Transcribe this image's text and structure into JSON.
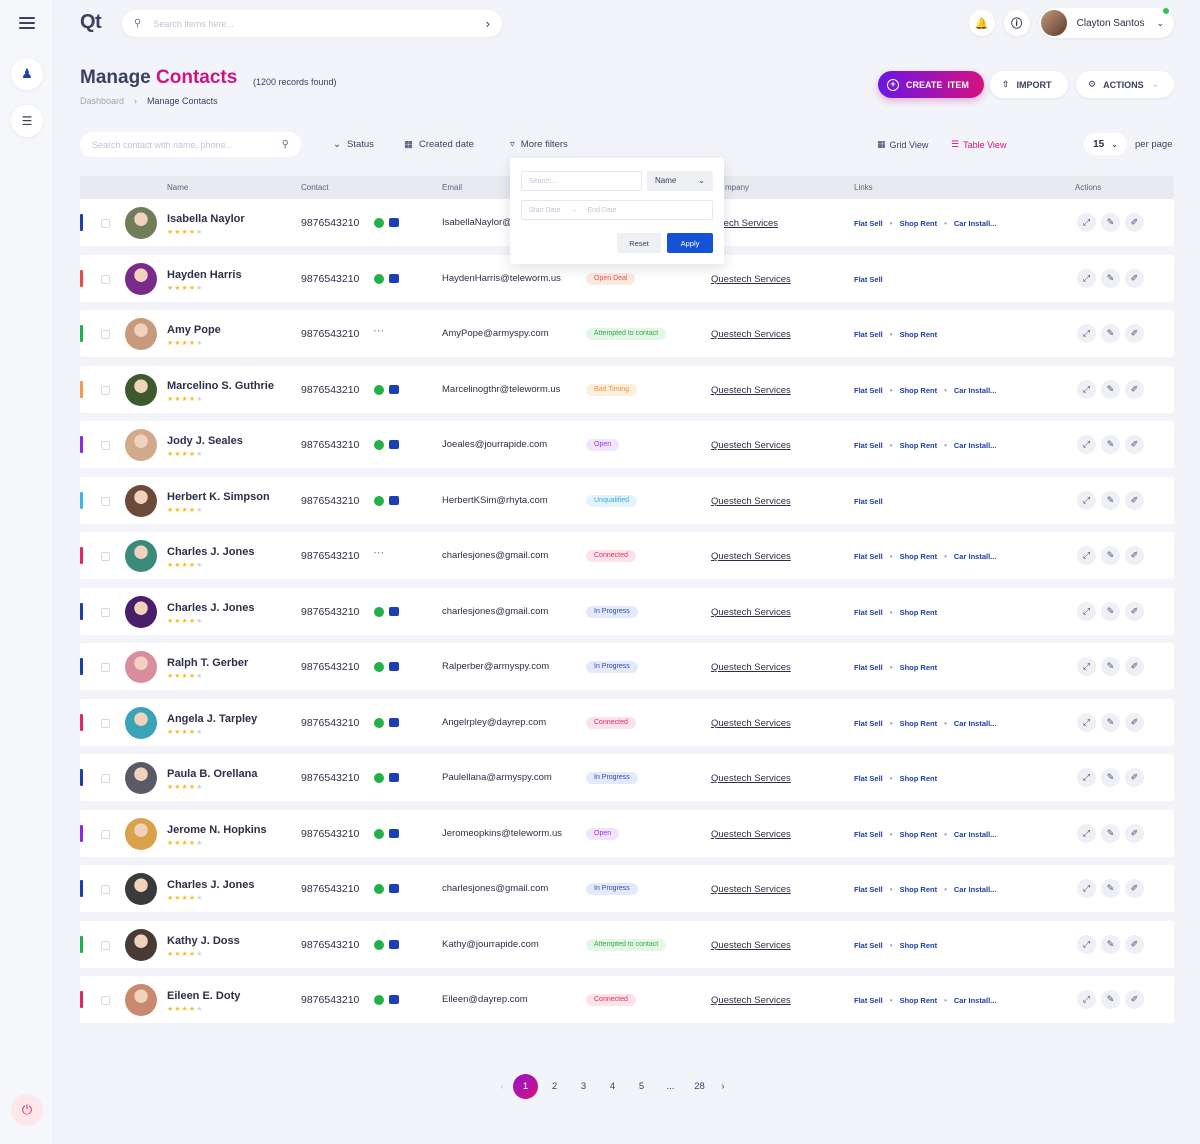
{
  "app": {
    "logo": "Qt"
  },
  "search": {
    "placeholder": "Search items here..."
  },
  "user": {
    "name": "Clayton Santos"
  },
  "header": {
    "title_part1": "Manage ",
    "title_part2": "Contacts",
    "records": "(1200 records found)"
  },
  "breadcrumb": {
    "home": "Dashboard",
    "separator": "›",
    "current": "Manage Contacts"
  },
  "toolbar": {
    "create_label": "CREATE  ITEM",
    "import_label": "IMPORT",
    "actions_label": "ACTIONS"
  },
  "filters": {
    "search_placeholder": "Search contact with name, phone...",
    "status": "Status",
    "created_date": "Created date",
    "more_filters": "More filters",
    "grid_view": "Grid View",
    "table_view": "Table View",
    "per_page_value": "15",
    "per_page_label": "per page"
  },
  "dropdown": {
    "search_placeholder": "Search...",
    "select_value": "Name",
    "start_date": "Start Date",
    "date_sep": "→",
    "end_date": "End Date",
    "reset": "Reset",
    "apply": "Apply"
  },
  "table": {
    "headers": {
      "name": "Name",
      "contact": "Contact",
      "email": "Email",
      "company": "mpany",
      "links": "Links",
      "actions": "Actions"
    },
    "company_name": "Questech Services",
    "link_labels": [
      "Flat Sell",
      "Shop Rent",
      "Car Install..."
    ],
    "rows": [
      {
        "name": "Isabella Naylor",
        "phone": "9876543210",
        "email": "IsabellaNaylor@",
        "status": "",
        "links": 3,
        "color": "#1e3ea8",
        "icons": true,
        "company": "estech Services",
        "avatar": "#6f7d5a"
      },
      {
        "name": "Hayden Harris",
        "phone": "9876543210",
        "email": "HaydenHarris@teleworm.us",
        "status": "Open Deal",
        "links": 1,
        "color": "#f04a3e",
        "icons": true,
        "avatar": "#7a2a8a"
      },
      {
        "name": "Amy Pope",
        "phone": "9876543210",
        "email": "AmyPope@armyspy.com",
        "status": "Attempted to contact",
        "links": 2,
        "color": "#22b04a",
        "icons": false,
        "avatar": "#c89a7d"
      },
      {
        "name": "Marcelino S. Guthrie",
        "phone": "9876543210",
        "email": "Marcelinogthr@teleworm.us",
        "status": "Bad Timing",
        "links": 3,
        "color": "#f49a4c",
        "icons": true,
        "avatar": "#3e5a2c"
      },
      {
        "name": "Jody J. Seales",
        "phone": "9876543210",
        "email": "Joeales@jourrapide.com",
        "status": "Open",
        "links": 3,
        "color": "#8a2be2",
        "icons": true,
        "avatar": "#d2a98a"
      },
      {
        "name": "Herbert K. Simpson",
        "phone": "9876543210",
        "email": "HerbertKSim@rhyta.com",
        "status": "Unqualified",
        "links": 1,
        "color": "#3fb4e8",
        "icons": true,
        "avatar": "#6b4a3c"
      },
      {
        "name": "Charles J. Jones",
        "phone": "9876543210",
        "email": "charlesjones@gmail.com",
        "status": "Connected",
        "links": 3,
        "color": "#e0295f",
        "icons": false,
        "avatar": "#3b8a7a"
      },
      {
        "name": "Charles J. Jones",
        "phone": "9876543210",
        "email": "charlesjones@gmail.com",
        "status": "In Progress",
        "links": 2,
        "color": "#1e3ea8",
        "icons": true,
        "avatar": "#4a1e6a"
      },
      {
        "name": "Ralph T. Gerber",
        "phone": "9876543210",
        "email": "Ralperber@armyspy.com",
        "status": "In Progress",
        "links": 2,
        "color": "#1e3ea8",
        "icons": true,
        "avatar": "#d98ea0"
      },
      {
        "name": "Angela J. Tarpley",
        "phone": "9876543210",
        "email": "Angelrpley@dayrep.com",
        "status": "Connected",
        "links": 3,
        "color": "#e0295f",
        "icons": true,
        "avatar": "#3aa3b8"
      },
      {
        "name": "Paula B. Orellana",
        "phone": "9876543210",
        "email": "Paulellana@armyspy.com",
        "status": "In Progress",
        "links": 2,
        "color": "#1e3ea8",
        "icons": true,
        "avatar": "#5a5a66"
      },
      {
        "name": "Jerome N. Hopkins",
        "phone": "9876543210",
        "email": "Jeromeopkins@teleworm.us",
        "status": "Open",
        "links": 3,
        "color": "#8a2be2",
        "icons": true,
        "avatar": "#d9a24a"
      },
      {
        "name": "Charles J. Jones",
        "phone": "9876543210",
        "email": "charlesjones@gmail.com",
        "status": "In Progress",
        "links": 3,
        "color": "#1e3ea8",
        "icons": true,
        "avatar": "#3a3a3a"
      },
      {
        "name": "Kathy J. Doss",
        "phone": "9876543210",
        "email": "Kathy@jourrapide.com",
        "status": "Attempted to contact",
        "links": 2,
        "color": "#22b04a",
        "icons": true,
        "avatar": "#4a3a36"
      },
      {
        "name": "Eileen E. Doty",
        "phone": "9876543210",
        "email": "Eileen@dayrep.com",
        "status": "Connected",
        "links": 3,
        "color": "#e0295f",
        "icons": true,
        "avatar": "#c8896f"
      }
    ]
  },
  "status_styles": {
    "Open Deal": {
      "bg": "#fde8e4",
      "fg": "#ef5b45"
    },
    "Attempted to contact": {
      "bg": "#e4f7e6",
      "fg": "#2fa74a"
    },
    "Bad Timing": {
      "bg": "#fdeedd",
      "fg": "#f29640"
    },
    "Open": {
      "bg": "#f2e4fd",
      "fg": "#9a32dd"
    },
    "Unqualified": {
      "bg": "#e2f4fc",
      "fg": "#3aa9de"
    },
    "Connected": {
      "bg": "#fde2ea",
      "fg": "#df2e60"
    },
    "In Progress": {
      "bg": "#e4e9fb",
      "fg": "#2b4ab8"
    }
  },
  "pagination": {
    "prev": "‹",
    "pages": [
      "1",
      "2",
      "3",
      "4",
      "5",
      "...",
      "28"
    ],
    "next": "›"
  }
}
